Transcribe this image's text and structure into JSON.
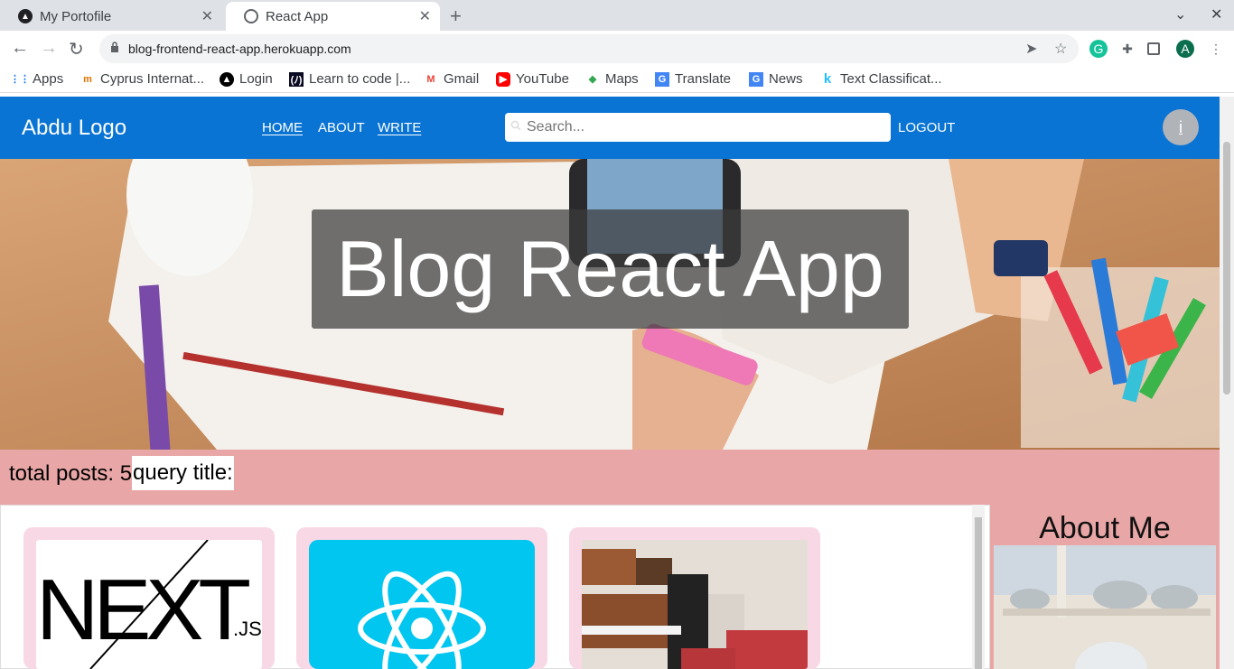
{
  "browser": {
    "tabs": [
      {
        "title": "My Portofile",
        "active": false
      },
      {
        "title": "React App",
        "active": true
      }
    ],
    "url": "blog-frontend-react-app.herokuapp.com",
    "profile_initial": "A",
    "bookmarks": [
      {
        "label": "Apps",
        "icon": "apps-grid-icon"
      },
      {
        "label": "Cyprus Internat...",
        "icon": "cyprus-icon"
      },
      {
        "label": "Login",
        "icon": "login-icon"
      },
      {
        "label": "Learn to code |...",
        "icon": "freecodecamp-icon"
      },
      {
        "label": "Gmail",
        "icon": "gmail-icon"
      },
      {
        "label": "YouTube",
        "icon": "youtube-icon"
      },
      {
        "label": "Maps",
        "icon": "maps-icon"
      },
      {
        "label": "Translate",
        "icon": "translate-icon"
      },
      {
        "label": "News",
        "icon": "news-icon"
      },
      {
        "label": "Text Classificat...",
        "icon": "kaggle-icon"
      }
    ]
  },
  "navbar": {
    "brand": "Abdu Logo",
    "links": [
      "HOME",
      "ABOUT",
      "WRITE"
    ],
    "search_placeholder": "Search...",
    "logout": "LOGOUT",
    "avatar_text": "i"
  },
  "hero": {
    "title": "Blog React App"
  },
  "posts": {
    "total_label": "total posts: 5",
    "query_label": "query title:",
    "cards": [
      {
        "image": "nextjs-logo"
      },
      {
        "image": "react-logo"
      },
      {
        "image": "kitchen-photo"
      }
    ]
  },
  "sidebar": {
    "title": "About Me",
    "image": "mosque-photo"
  },
  "colors": {
    "navbar": "#0a74d4",
    "page_bg": "#e8a7a6",
    "card_bg": "#f9d8e6"
  }
}
